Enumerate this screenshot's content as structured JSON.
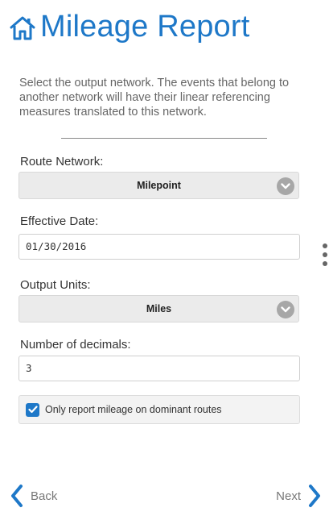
{
  "header": {
    "title": "Mileage Report",
    "icon": "home-icon"
  },
  "description": "Select the output network. The events that belong to another network will have their linear referencing measures translated to this network.",
  "route_network": {
    "label": "Route Network:",
    "value": "Milepoint"
  },
  "effective_date": {
    "label": "Effective Date:",
    "value": "01/30/2016"
  },
  "output_units": {
    "label": "Output Units:",
    "value": "Miles"
  },
  "decimals": {
    "label": "Number of decimals:",
    "value": "3"
  },
  "dominant": {
    "label": "Only report mileage on dominant routes",
    "checked": true
  },
  "nav": {
    "back_label": "Back",
    "next_label": "Next"
  },
  "colors": {
    "accent": "#1e78c8",
    "chevron_bg": "#a7a7a7"
  }
}
